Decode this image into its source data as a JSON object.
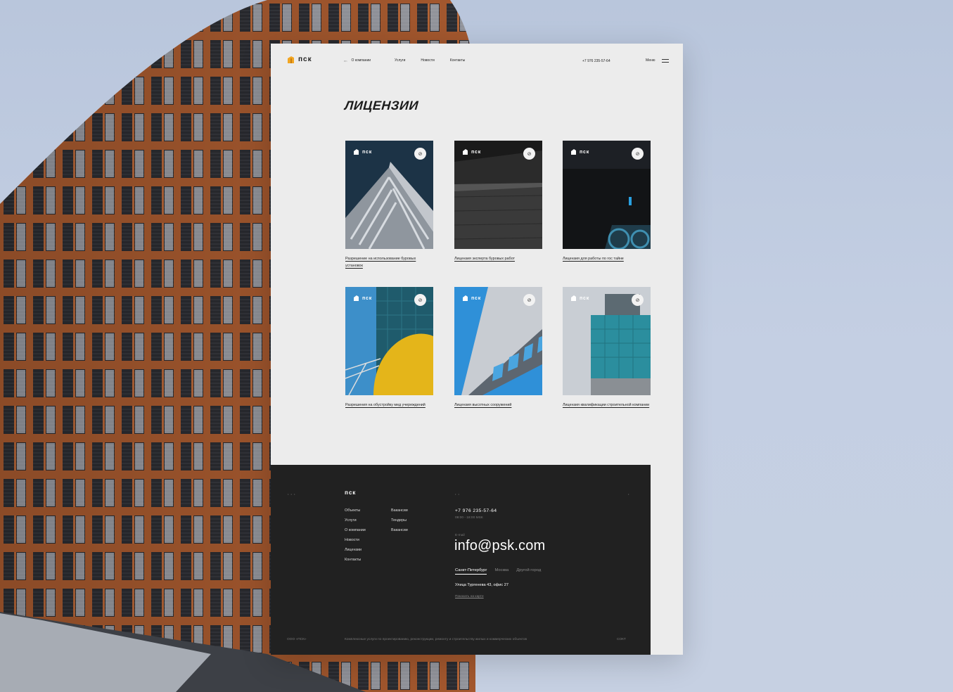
{
  "header": {
    "logo_text": "пск",
    "lang": "en",
    "nav": [
      "О компании",
      "Услуги",
      "Новости",
      "Контакты"
    ],
    "phone": "+7 976 235-57-64",
    "menu_label": "Меню"
  },
  "page_title": "ЛИЦЕНЗИИ",
  "cards": [
    {
      "badge": "пск",
      "caption": "Разрешение на использование буровых установок"
    },
    {
      "badge": "пск",
      "caption": "Лицензия эксперта буровых работ"
    },
    {
      "badge": "пск",
      "caption": "Лицензия для работы по гос тайне"
    },
    {
      "badge": "пск",
      "caption": "Разрешения на обустройку мед учереждений"
    },
    {
      "badge": "пск",
      "caption": "Лицензия высотных сооружений"
    },
    {
      "badge": "пск",
      "caption": "Лицензия квалификации строительной компании"
    }
  ],
  "footer": {
    "logo_text": "пск",
    "links_col1": [
      "Объекты",
      "Услуги",
      "О компании",
      "Новости",
      "Лицензии",
      "Контакты"
    ],
    "links_col2": [
      "Вакансии",
      "Тендеры",
      "Вакансии"
    ],
    "phone": "+7 976 235-57-64",
    "hours": "08:00 - 18:00 MSK",
    "email_label": "E-mail",
    "email": "info@psk.com",
    "cities": [
      "Санкт-Петербург",
      "Москва",
      "Другой город"
    ],
    "address": "Улица Тургенева 43, офис 27",
    "map_link": "Показать на карте",
    "company": "ООО «ПСК»",
    "description": "Комплексные услуги по проектированию, реконструкции, ремонту и строительству жилых и коммерческих объектов",
    "credit": "СОКТ"
  },
  "colors": {
    "accent": "#f2a623",
    "sheet_bg": "#ececec",
    "footer_bg": "#212121"
  }
}
